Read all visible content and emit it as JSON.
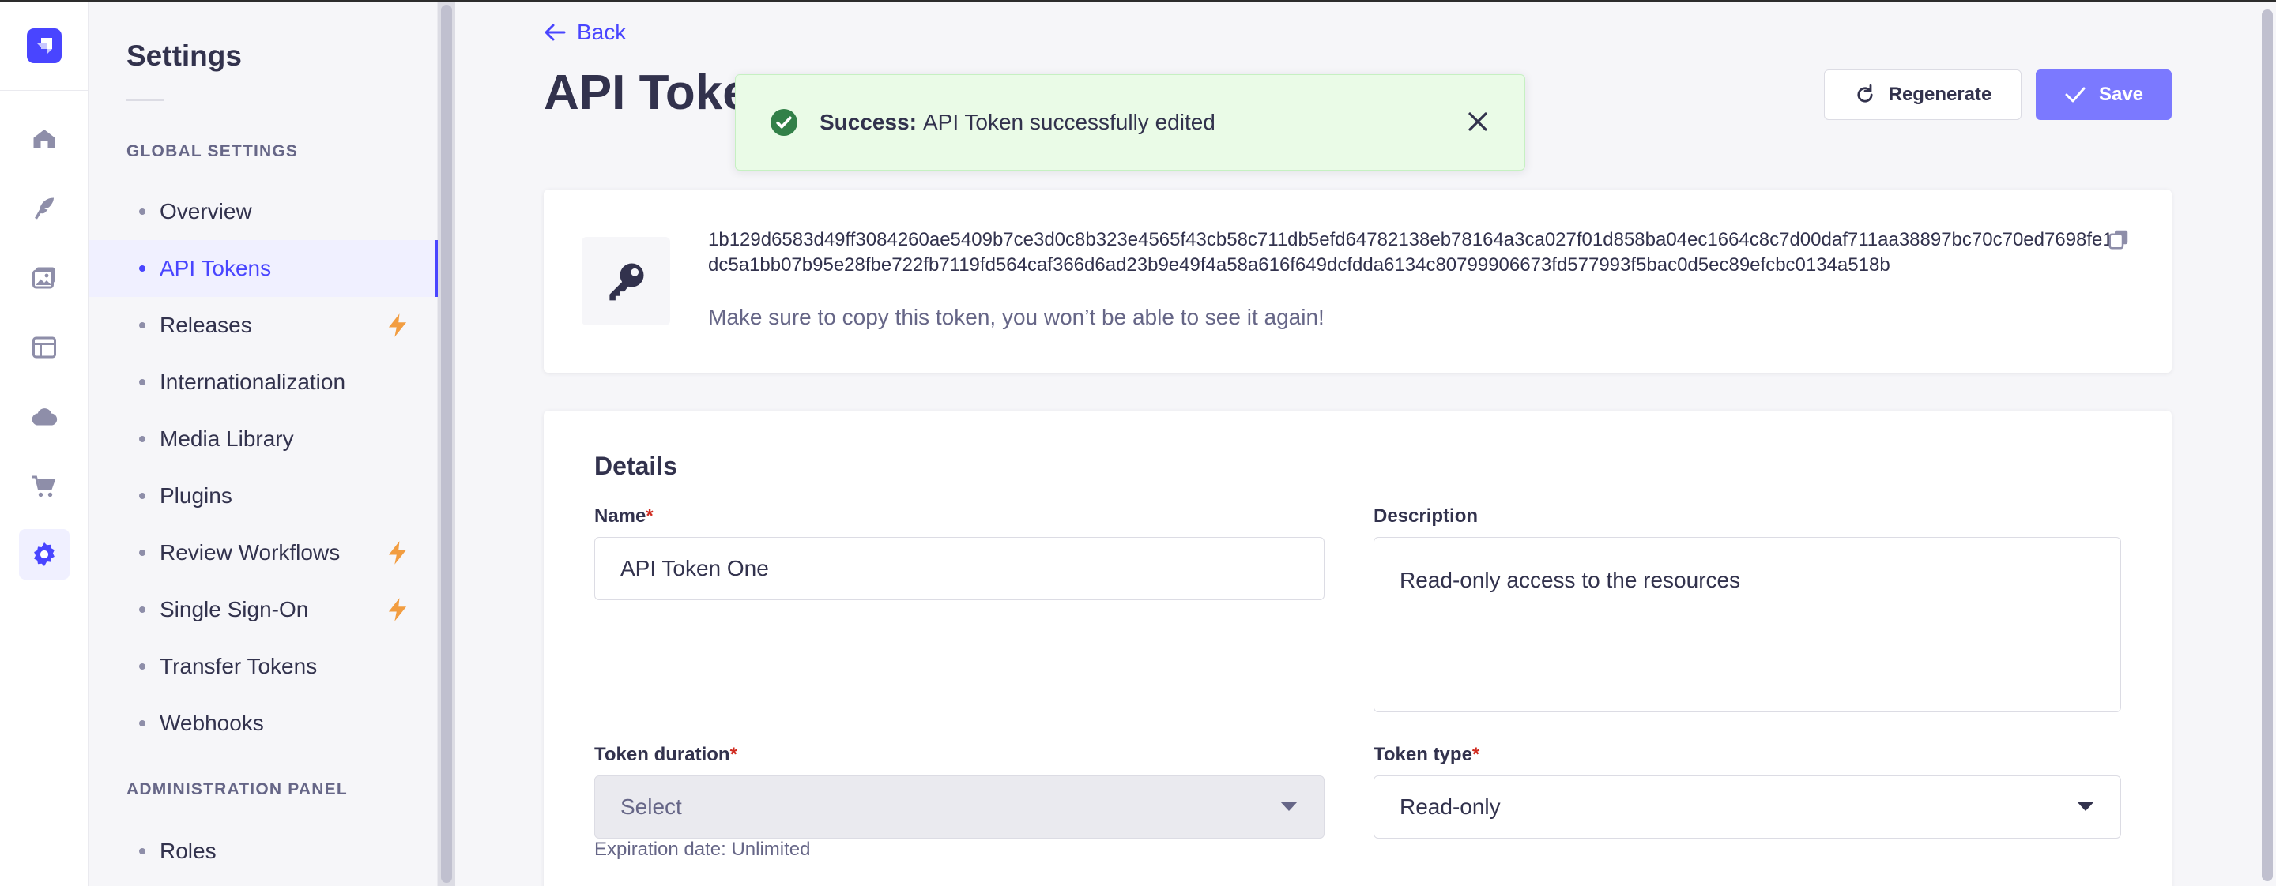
{
  "colors": {
    "primary": "#4945ff",
    "success": "#328048",
    "danger": "#d02b20",
    "bolt": "#f29d41"
  },
  "rail": {
    "items": [
      {
        "name": "home-icon"
      },
      {
        "name": "content-manager-icon"
      },
      {
        "name": "media-library-icon"
      },
      {
        "name": "content-type-builder-icon"
      },
      {
        "name": "cloud-icon"
      },
      {
        "name": "marketplace-icon"
      },
      {
        "name": "settings-icon",
        "active": true
      }
    ]
  },
  "subnav": {
    "title": "Settings",
    "global_label": "Global Settings",
    "items": [
      {
        "label": "Overview"
      },
      {
        "label": "API Tokens",
        "active": true
      },
      {
        "label": "Releases",
        "bolt": true
      },
      {
        "label": "Internationalization"
      },
      {
        "label": "Media Library"
      },
      {
        "label": "Plugins"
      },
      {
        "label": "Review Workflows",
        "bolt": true
      },
      {
        "label": "Single Sign-On",
        "bolt": true
      },
      {
        "label": "Transfer Tokens"
      },
      {
        "label": "Webhooks"
      }
    ],
    "admin_label": "Administration Panel",
    "admin_items": [
      {
        "label": "Roles"
      }
    ]
  },
  "header": {
    "back_label": "Back",
    "title": "API Token One",
    "regenerate_label": "Regenerate",
    "save_label": "Save"
  },
  "toast": {
    "title": "Success:",
    "message": "API Token successfully edited"
  },
  "token": {
    "value": "1b129d6583d49ff3084260ae5409b7ce3d0c8b323e4565f43cb58c711db5efd64782138eb78164a3ca027f01d858ba04ec1664c8c7d00daf711aa38897bc70c70ed7698fe1dc5a1bb07b95e28fbe722fb7119fd564caf366d6ad23b9e49f4a58a616f649dcfdda6134c80799906673fd577993f5bac0d5ec89efcbc0134a518b",
    "hint": "Make sure to copy this token, you won’t be able to see it again!"
  },
  "details": {
    "title": "Details",
    "name_label": "Name",
    "name_value": "API Token One",
    "description_label": "Description",
    "description_value": "Read-only access to the resources",
    "duration_label": "Token duration",
    "duration_value": "Select",
    "expiration_hint": "Expiration date: Unlimited",
    "type_label": "Token type",
    "type_value": "Read-only",
    "required_mark": "*"
  }
}
